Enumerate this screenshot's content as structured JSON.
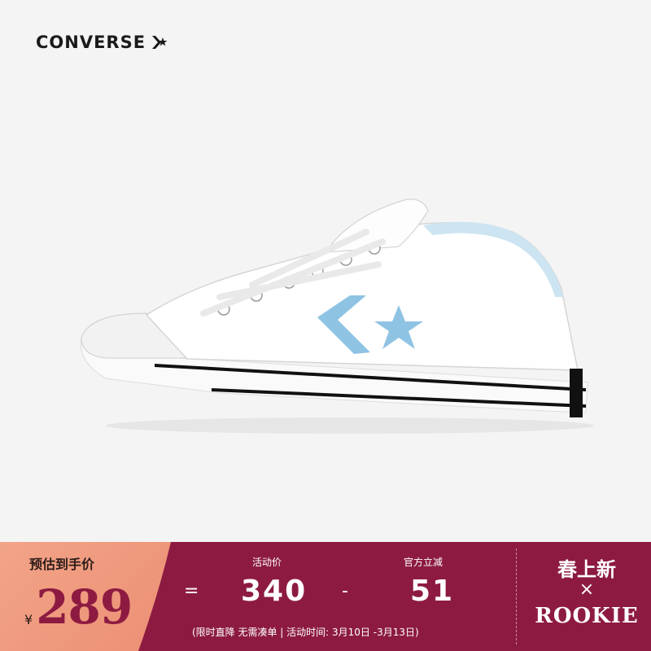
{
  "brand": {
    "name": "CONVERSE"
  },
  "product": {
    "image": "white-low-top-sneaker-light-blue-star-chevron"
  },
  "promo": {
    "preorder_label": "预估到手价",
    "currency": "¥",
    "final_price": "289",
    "equals": "=",
    "activity_price_label": "活动价",
    "activity_price": "340",
    "minus": "-",
    "discount_label": "官方立减",
    "discount": "51",
    "note": "(限时直降 无需凑单 | 活动时间: 3月10日 -3月13日)",
    "side_title": "春上新",
    "side_x": "×",
    "side_brand": "ROOKIE",
    "colors": {
      "maroon": "#8d1b41",
      "peach": "#ef9a7e",
      "star_blue": "#8fc3e4"
    }
  }
}
